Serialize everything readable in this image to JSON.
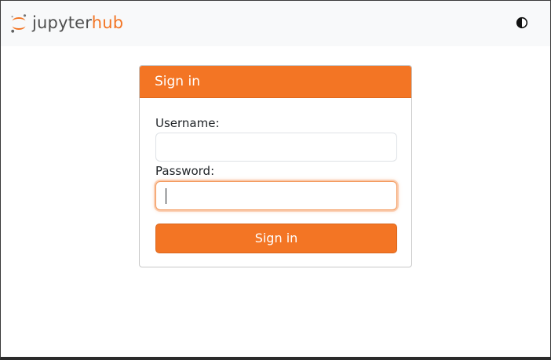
{
  "navbar": {
    "logo_text_jupyter": "jupyter",
    "logo_text_hub": "hub",
    "logo_icon": "jupyter-logo-icon",
    "theme_toggle_icon": "contrast-icon"
  },
  "login": {
    "header": "Sign in",
    "username_label": "Username:",
    "username_value": "",
    "password_label": "Password:",
    "password_value": "",
    "submit_label": "Sign in"
  },
  "colors": {
    "accent": "#f37524",
    "navbar_bg": "#f8f9fa",
    "logo_text": "#4e4e4e"
  }
}
